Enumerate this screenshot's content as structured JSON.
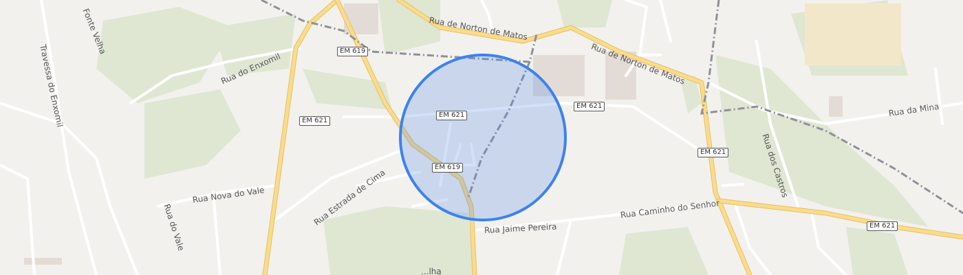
{
  "map": {
    "colors": {
      "background": "#f3f1ee",
      "green_area": "#dfe7d3",
      "main_road_fill": "#f9dc8c",
      "main_road_casing": "#e5bf62",
      "minor_road": "#ffffff",
      "railway": "#8e9099",
      "accuracy_circle_fill": "#4a89e8",
      "accuracy_circle_stroke": "#3b82f0"
    },
    "street_names": {
      "fonte_velha": "Fonte Velha",
      "travessa_enxomil": "Travessa do Enxomil",
      "rua_enxomil": "Rua do Enxomil",
      "norton_matos_1": "Rua de Norton de Matos",
      "norton_matos_2": "Rua de Norton de Matos",
      "rua_mina": "Rua da Mina",
      "rua_castros": "Rua dos Castros",
      "rua_nova_vale": "Rua Nova do Vale",
      "rua_vale": "Rua do Vale",
      "rua_estrada_cima": "Rua Estrada de Cima",
      "rua_caminho_senhor": "Rua Caminho do Senhor",
      "rua_jaime_pereira": "Rua Jaime Pereira",
      "partial_bottom": "...lha"
    },
    "route_shields": {
      "em619_top": "EM 619",
      "em619_center": "EM 619",
      "em621_left": "EM 621",
      "em621_center": "EM 621",
      "em621_right_top": "EM 621",
      "em621_right": "EM 621",
      "em621_far_right": "EM 621"
    }
  }
}
